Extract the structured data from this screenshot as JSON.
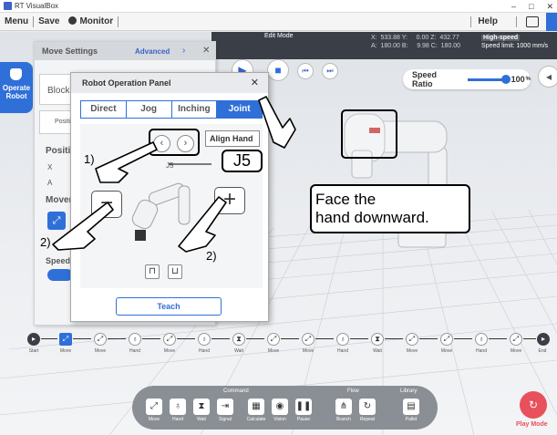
{
  "window": {
    "title": "RT VisualBox",
    "min": "–",
    "max": "□",
    "close": "✕"
  },
  "menu": {
    "menu": "Menu",
    "save": "Save",
    "monitor": "Monitor",
    "help": "Help"
  },
  "editbar": {
    "label": "Edit Mode",
    "coords": "X:  533.88 Y:     0.00 Z:  432.77\nA:  180.00 B:     9.98 C:  180.00",
    "high_speed": "High-speed",
    "speed_limit": "Speed limit:   1000 mm/s"
  },
  "speed": {
    "label": "Speed Ratio",
    "value": "100",
    "unit": "%"
  },
  "operate": {
    "label": "Operate Robot"
  },
  "move_settings": {
    "title": "Move Settings",
    "advanced": "Advanced",
    "block": "Block",
    "position_small": "Positio",
    "position": "Positio",
    "x": "X",
    "a": "A",
    "movement": "Movem",
    "speed": "Speed"
  },
  "rop": {
    "title": "Robot Operation Panel",
    "close": "✕",
    "tabs": [
      "Direct",
      "Jog",
      "Inching",
      "Joint"
    ],
    "align": "Align Hand",
    "joint_label": "J5",
    "minus": "−",
    "plus": "+",
    "teach": "Teach"
  },
  "annotations": {
    "step1": "1)",
    "step2a": "2)",
    "step2b": "2)",
    "j5": "J5",
    "face_line1": "Face the",
    "face_line2": "hand downward."
  },
  "timeline": {
    "start": "Start",
    "end": "End",
    "move": "Move",
    "hand": "Hand",
    "wait": "Wait"
  },
  "command": {
    "header": "Command",
    "flow": "Flow",
    "library": "Library",
    "buttons": [
      "Move",
      "Hand",
      "Wait",
      "Signal",
      "Calculate",
      "Vision",
      "Pause",
      "Branch",
      "Repeat",
      "Pallet"
    ]
  },
  "play": {
    "label": "Play Mode"
  },
  "colors": {
    "accent": "#2f6fd8",
    "play": "#e8505b",
    "dark": "#3a3f47"
  }
}
